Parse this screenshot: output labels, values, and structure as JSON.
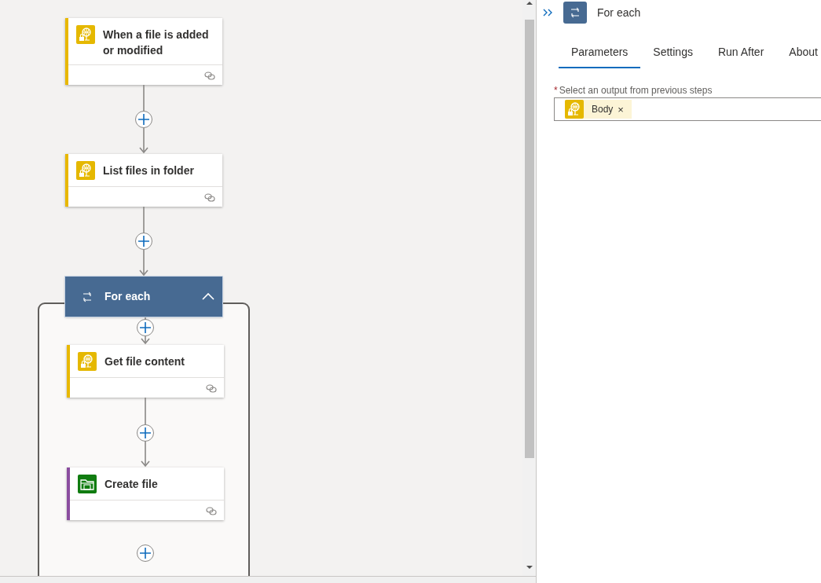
{
  "canvas": {
    "steps": [
      {
        "kind": "globe",
        "title": "When a file is added or modified",
        "color": "#e8b800"
      },
      {
        "kind": "globe",
        "title": "List files in folder",
        "color": "#e8b800"
      }
    ],
    "loop": {
      "title": "For each",
      "expanded": true,
      "steps": [
        {
          "kind": "globe",
          "title": "Get file content",
          "color": "#e8b800"
        },
        {
          "kind": "folder",
          "title": "Create file",
          "color": "#8a4d9f"
        }
      ]
    }
  },
  "panel": {
    "title": "For each",
    "tabs": [
      {
        "label": "Parameters",
        "selected": true
      },
      {
        "label": "Settings",
        "selected": false
      },
      {
        "label": "Run After",
        "selected": false
      },
      {
        "label": "About",
        "selected": false
      }
    ],
    "field": {
      "required": true,
      "required_mark": "*",
      "label": "Select an output from previous steps",
      "tokens": [
        {
          "kind": "globe",
          "label": "Body",
          "remove": "×"
        }
      ]
    }
  }
}
